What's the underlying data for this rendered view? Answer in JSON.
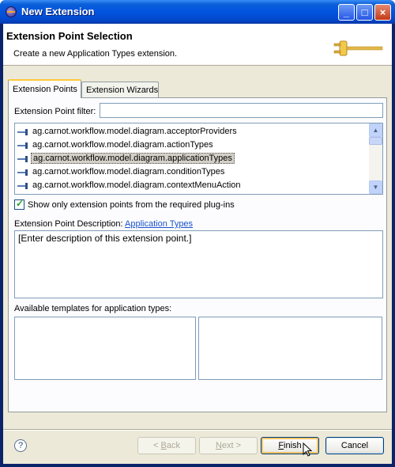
{
  "window": {
    "title": "New Extension"
  },
  "titlebar_buttons": {
    "minimize": "_",
    "maximize": "□",
    "close": "×"
  },
  "header": {
    "title": "Extension Point Selection",
    "description": "Create a new Application Types extension."
  },
  "tabs": [
    {
      "label": "Extension Points",
      "active": true
    },
    {
      "label": "Extension Wizards",
      "active": false
    }
  ],
  "filter": {
    "label": "Extension Point filter:",
    "value": ""
  },
  "extension_points": [
    {
      "label": "ag.carnot.workflow.model.diagram.acceptorProviders",
      "selected": false
    },
    {
      "label": "ag.carnot.workflow.model.diagram.actionTypes",
      "selected": false
    },
    {
      "label": "ag.carnot.workflow.model.diagram.applicationTypes",
      "selected": true
    },
    {
      "label": "ag.carnot.workflow.model.diagram.conditionTypes",
      "selected": false
    },
    {
      "label": "ag.carnot.workflow.model.diagram.contextMenuAction",
      "selected": false
    }
  ],
  "scrollbar": {
    "up": "▲",
    "down": "▼"
  },
  "show_only_checkbox": {
    "label": "Show only extension points from the required plug-ins",
    "checked": true
  },
  "description": {
    "label": "Extension Point Description:",
    "link": "Application Types",
    "text": "[Enter description of this extension point.]"
  },
  "templates": {
    "label": "Available templates for application types:"
  },
  "help": {
    "symbol": "?"
  },
  "buttons": {
    "back": {
      "label": "< Back",
      "mnemonic": "B",
      "pre": "< ",
      "post": "ack",
      "enabled": false
    },
    "next": {
      "label": "Next >",
      "mnemonic": "N",
      "pre": "",
      "post": "ext >",
      "enabled": false
    },
    "finish": {
      "label": "Finish",
      "mnemonic": "F",
      "pre": "",
      "post": "inish",
      "enabled": true
    },
    "cancel": {
      "label": "Cancel",
      "enabled": true
    }
  },
  "colors": {
    "titlebar": "#0254e0",
    "dialog_bg": "#ece9d8",
    "link": "#1a52cc",
    "selection_bg": "#d4d0c8"
  }
}
